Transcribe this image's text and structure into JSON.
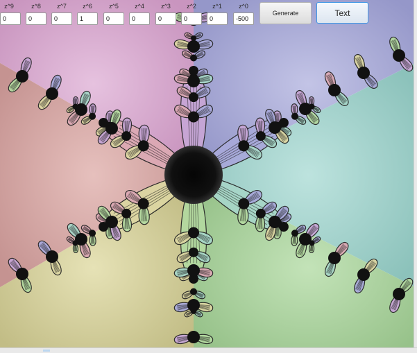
{
  "coefficients": [
    {
      "label": "z^9",
      "value": "0"
    },
    {
      "label": "z^8",
      "value": "0"
    },
    {
      "label": "z^7",
      "value": "0"
    },
    {
      "label": "z^6",
      "value": "1"
    },
    {
      "label": "z^5",
      "value": "0"
    },
    {
      "label": "z^4",
      "value": "0"
    },
    {
      "label": "z^3",
      "value": "0"
    },
    {
      "label": "z^2",
      "value": "0"
    },
    {
      "label": "z^1",
      "value": "0"
    },
    {
      "label": "z^0",
      "value": "-500"
    }
  ],
  "buttons": {
    "generate_label": "Generate",
    "text_label": "Text"
  },
  "colors": {
    "region_1": "#d6a8cc",
    "region_2": "#a5a6d4",
    "region_3": "#9fd1cb",
    "region_4": "#a7cf9b",
    "region_5": "#d3cf9a",
    "region_6": "#d6a5a4",
    "petal_dark": "#141414",
    "focus_blue": "#3e97e6"
  }
}
